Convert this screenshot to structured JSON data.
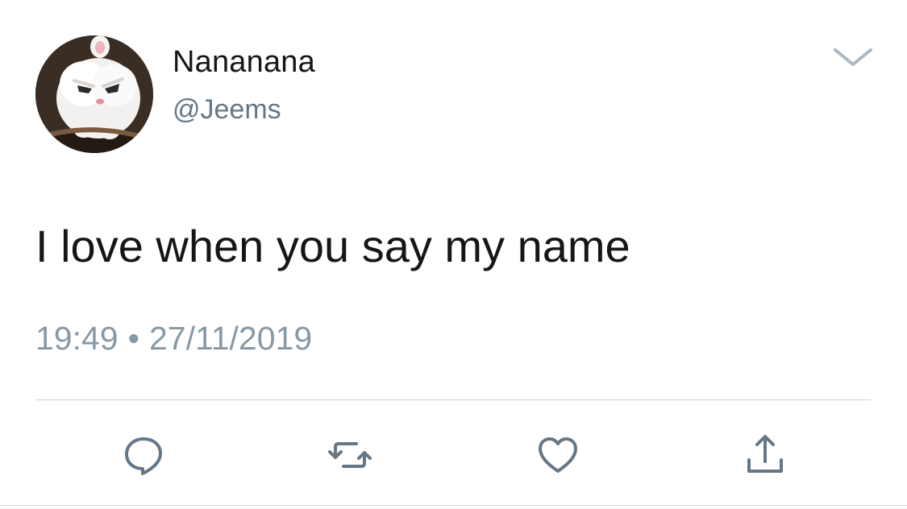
{
  "tweet": {
    "display_name": "Nananana",
    "handle": "@Jeems",
    "text": "I love when you say my name",
    "time": "19:49",
    "separator": "•",
    "date": "27/11/2019"
  },
  "icons": {
    "menu": "chevron-down-icon",
    "reply": "reply-icon",
    "retweet": "retweet-icon",
    "like": "heart-icon",
    "share": "share-icon"
  },
  "colors": {
    "primary_text": "#14171a",
    "secondary_text": "#657786",
    "meta_text": "#8899a6",
    "icon": "#657786",
    "divider": "#ccd6dd"
  }
}
